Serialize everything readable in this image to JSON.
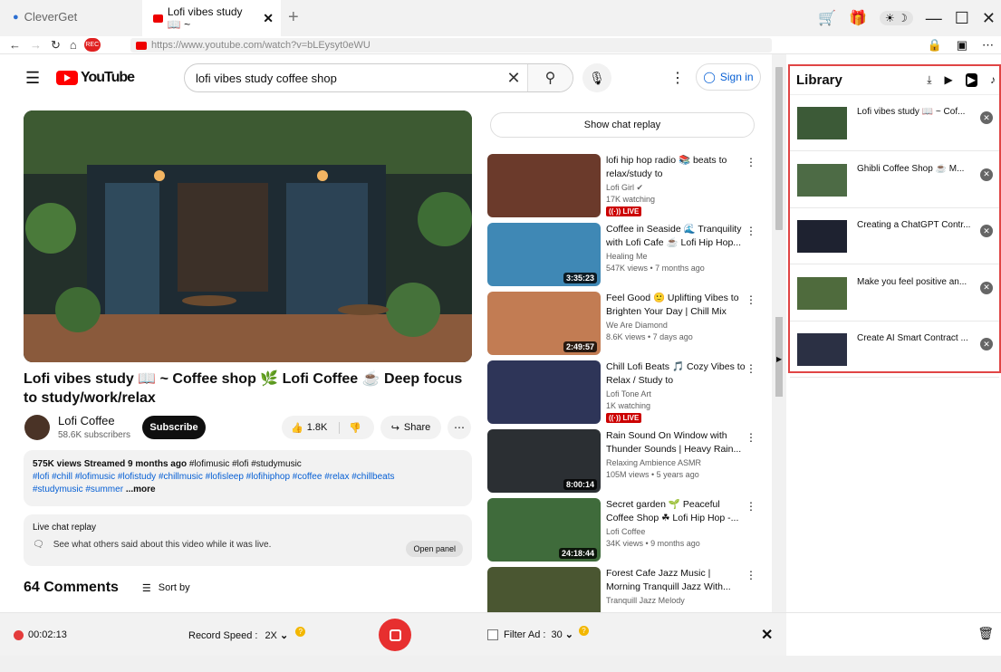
{
  "browser": {
    "tab_inactive": "CleverGet",
    "tab_active": "Lofi vibes study 📖 ~",
    "url": "https://www.youtube.com/watch?v=bLEysyt0eWU",
    "rec_badge": "REC"
  },
  "youtube": {
    "logo": "YouTube",
    "search_value": "lofi vibes study coffee shop",
    "signin": "Sign in",
    "video_title": "Lofi vibes study 📖 ~ Coffee shop 🌿 Lofi Coffee ☕ Deep focus to study/work/relax",
    "channel": "Lofi Coffee",
    "subscribers": "58.6K subscribers",
    "subscribe": "Subscribe",
    "likes": "1.8K",
    "share": "Share",
    "desc_stats": "575K views  Streamed 9 months ago",
    "desc_tags1": " #lofimusic #lofi #studymusic",
    "desc_tags2": "#lofi #chill #lofimusic #lofistudy #chillmusic #lofisleep #lofihiphop #coffee  #relax #chillbeats",
    "desc_tags3": "#studymusic #summer",
    "desc_more": "...more",
    "chat_title": "Live chat replay",
    "chat_sub": "See what others said about this video while it was live.",
    "open_panel": "Open panel",
    "comments": "64 Comments",
    "sort_by": "Sort by",
    "show_chat_replay": "Show chat replay",
    "recommendations": [
      {
        "title": "lofi hip hop radio 📚 beats to relax/study to",
        "channel": "Lofi Girl ✔",
        "meta": "17K watching",
        "live": "((·)) LIVE",
        "duration": "",
        "color": "#6b3a2b"
      },
      {
        "title": "Coffee in Seaside 🌊 Tranquility with Lofi Cafe ☕ Lofi Hip Hop...",
        "channel": "Healing Me",
        "meta": "547K views • 7 months ago",
        "live": "",
        "duration": "3:35:23",
        "color": "#3f88b5"
      },
      {
        "title": "Feel Good 🙂 Uplifting Vibes to Brighten Your Day | Chill Mix",
        "channel": "We Are Diamond",
        "meta": "8.6K views • 7 days ago",
        "live": "",
        "duration": "2:49:57",
        "color": "#c27c53"
      },
      {
        "title": "Chill Lofi Beats 🎵 Cozy Vibes to Relax / Study to",
        "channel": "Lofi Tone Art",
        "meta": "1K watching",
        "live": "((·)) LIVE",
        "duration": "",
        "color": "#2e3558"
      },
      {
        "title": "Rain Sound On Window with Thunder Sounds | Heavy Rain...",
        "channel": "Relaxing Ambience ASMR",
        "meta": "105M views • 5 years ago",
        "live": "",
        "duration": "8:00:14",
        "color": "#2b2f33"
      },
      {
        "title": "Secret garden 🌱 Peaceful Coffee Shop ☘ Lofi Hip Hop -...",
        "channel": "Lofi Coffee",
        "meta": "34K views • 9 months ago",
        "live": "",
        "duration": "24:18:44",
        "color": "#3f6b3b"
      },
      {
        "title": "Forest Cafe Jazz Music | Morning Tranquill Jazz With...",
        "channel": "Tranquill Jazz Melody",
        "meta": "",
        "live": "",
        "duration": "",
        "color": "#4a5631"
      }
    ]
  },
  "library": {
    "title": "Library",
    "items": [
      {
        "title": "Lofi vibes study 📖 ~ Cof...",
        "color": "#3c5a37"
      },
      {
        "title": "Ghibli Coffee Shop ☕ M...",
        "color": "#4d6b45"
      },
      {
        "title": "Creating a ChatGPT Contr...",
        "color": "#1e2230"
      },
      {
        "title": "Make you feel positive an...",
        "color": "#4f6b3d"
      },
      {
        "title": "Create AI Smart Contract ...",
        "color": "#2b3044"
      }
    ]
  },
  "recorder": {
    "timer": "00:02:13",
    "record_speed_label": "Record Speed :",
    "record_speed_value": "2X",
    "filter_label": "Filter Ad :",
    "filter_value": "30",
    "help": "?"
  }
}
